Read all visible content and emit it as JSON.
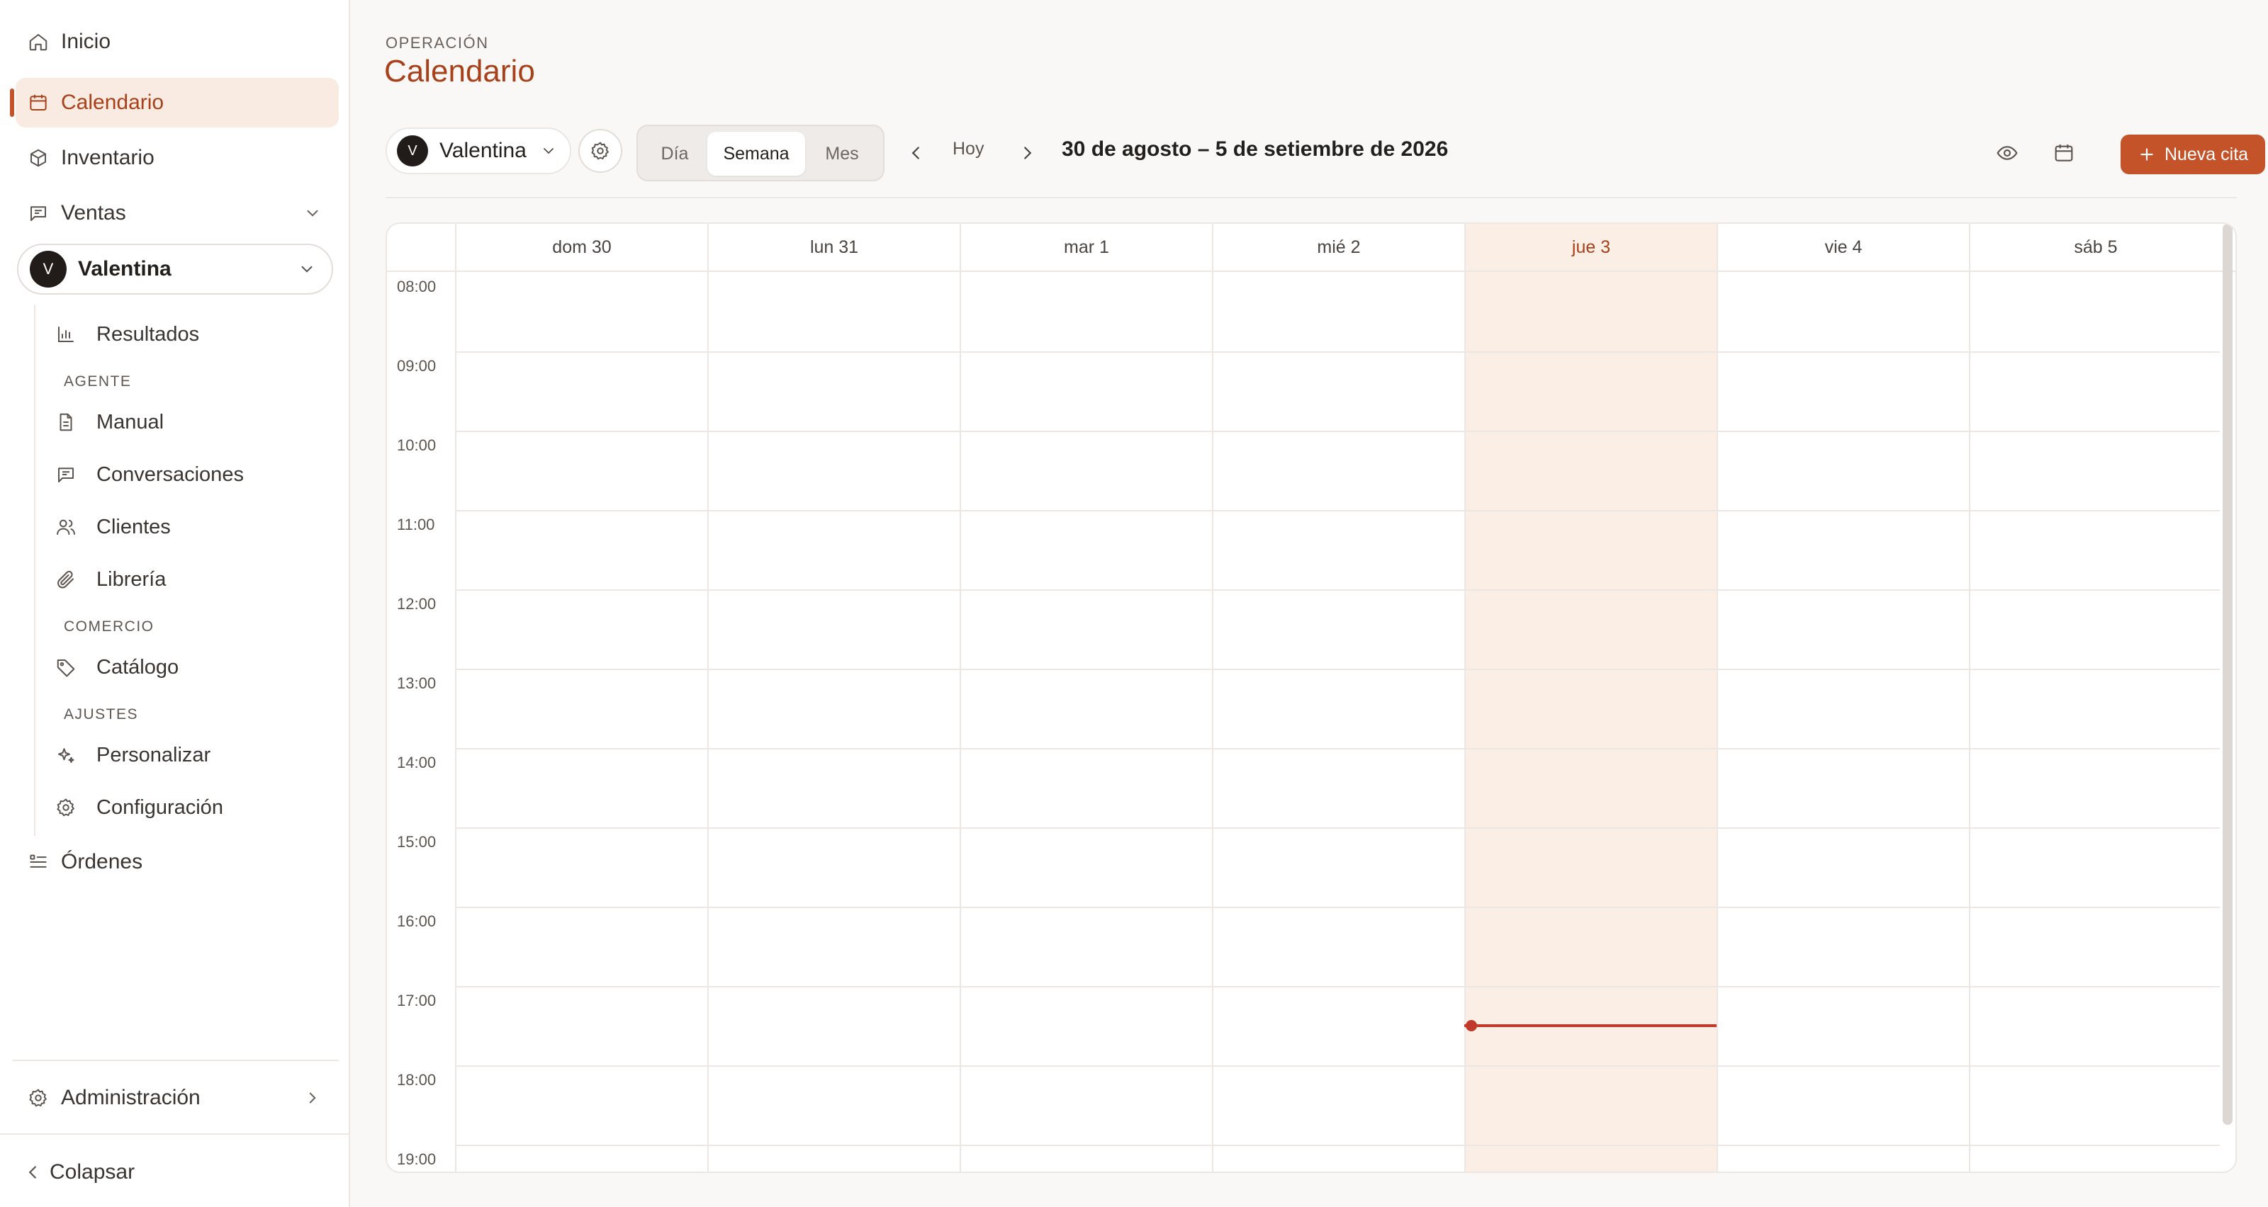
{
  "sidebar": {
    "nav": {
      "inicio": "Inicio",
      "calendario": "Calendario",
      "inventario": "Inventario",
      "ventas": "Ventas",
      "ordenes": "Órdenes",
      "administracion": "Administración",
      "colapsar": "Colapsar"
    },
    "agent": {
      "initial": "V",
      "name": "Valentina"
    },
    "sub": {
      "resultados": "Resultados",
      "agente_label": "AGENTE",
      "manual": "Manual",
      "conversaciones": "Conversaciones",
      "clientes": "Clientes",
      "libreria": "Librería",
      "comercio_label": "COMERCIO",
      "catalogo": "Catálogo",
      "ajustes_label": "AJUSTES",
      "personalizar": "Personalizar",
      "configuracion": "Configuración"
    }
  },
  "header": {
    "eyebrow": "OPERACIÓN",
    "title": "Calendario"
  },
  "toolbar": {
    "person": {
      "initial": "V",
      "name": "Valentina"
    },
    "views": [
      "Día",
      "Semana",
      "Mes"
    ],
    "selected_view": "Semana",
    "today": "Hoy",
    "range": "30 de agosto – 5 de setiembre de 2026",
    "new_button": "Nueva cita"
  },
  "calendar": {
    "days": [
      "dom 30",
      "lun 31",
      "mar 1",
      "mié 2",
      "jue 3",
      "vie 4",
      "sáb 5"
    ],
    "today_index": 4,
    "hours": [
      "08:00",
      "09:00",
      "10:00",
      "11:00",
      "12:00",
      "13:00",
      "14:00",
      "15:00",
      "16:00",
      "17:00",
      "18:00",
      "19:00"
    ],
    "current_time_fraction_of_hour_after_17": 0.5
  },
  "colors": {
    "accent": "#c4532a",
    "accent_text": "#a8401a",
    "today_bg": "#faeee5",
    "now_line": "#c0392b"
  }
}
